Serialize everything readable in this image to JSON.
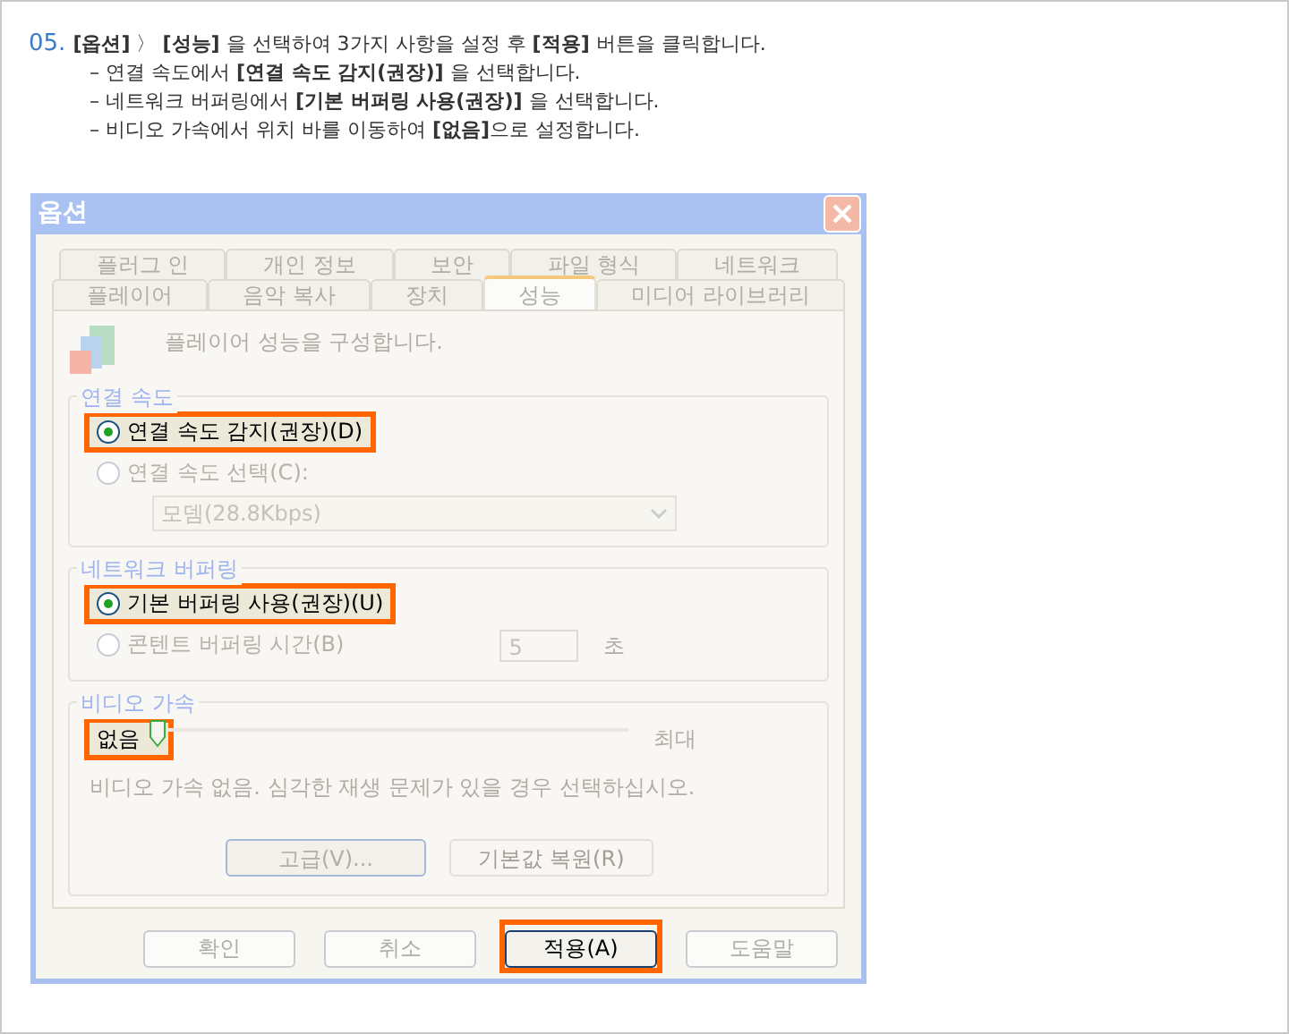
{
  "instructions": {
    "step": "05.",
    "lines": [
      "**[옵션]** 〉 **[성능]** 을 선택하여 3가지 사항을 설정 후 **[적용]** 버튼을 클릭합니다.",
      "– 연결 속도에서 **[연결 속도 감지(권장)]** 을 선택합니다.",
      "– 네트워크 버퍼링에서 **[기본 버퍼링 사용(권장)]** 을 선택합니다.",
      "– 비디오 가속에서 위치 바를 이동하여 **[없음]**으로 설정합니다."
    ]
  },
  "window": {
    "title": "옵션"
  },
  "tab_rows": [
    [
      {
        "label": "플러그 인",
        "selected": false
      },
      {
        "label": "개인 정보",
        "selected": false
      },
      {
        "label": "보안",
        "selected": false
      },
      {
        "label": "파일 형식",
        "selected": false
      },
      {
        "label": "네트워크",
        "selected": false
      }
    ],
    [
      {
        "label": "플레이어",
        "selected": false
      },
      {
        "label": "음악 복사",
        "selected": false
      },
      {
        "label": "장치",
        "selected": false
      },
      {
        "label": "성능",
        "selected": true
      },
      {
        "label": "미디어 라이브러리",
        "selected": false
      }
    ]
  ],
  "description": "플레이어 성능을 구성합니다.",
  "connection_speed": {
    "title": "연결 속도",
    "options": [
      {
        "label": "연결 속도 감지(권장)(D)",
        "selected": true,
        "highlighted": true
      },
      {
        "label": "연결 속도 선택(C):",
        "selected": false,
        "highlighted": false
      }
    ],
    "dropdown_value": "모뎀(28.8Kbps)"
  },
  "network_buffering": {
    "title": "네트워크 버퍼링",
    "options": [
      {
        "label": "기본 버퍼링 사용(권장)(U)",
        "selected": true,
        "highlighted": true
      },
      {
        "label": "콘텐트 버퍼링 시간(B)",
        "selected": false,
        "highlighted": false
      }
    ],
    "buffer_value": "5",
    "buffer_unit": "초"
  },
  "video_acceleration": {
    "title": "비디오 가속",
    "min_label": "없음",
    "min_highlighted": true,
    "max_label": "최대",
    "level": 0,
    "note": "비디오 가속 없음. 심각한 재생 문제가 있을 경우 선택하십시오.",
    "buttons": [
      "고급(V)...",
      "기본값 복원(R)"
    ]
  },
  "buttons": [
    {
      "label": "확인",
      "highlighted": false
    },
    {
      "label": "취소",
      "highlighted": false
    },
    {
      "label": "적용(A)",
      "highlighted": true
    },
    {
      "label": "도움말",
      "highlighted": false
    }
  ]
}
